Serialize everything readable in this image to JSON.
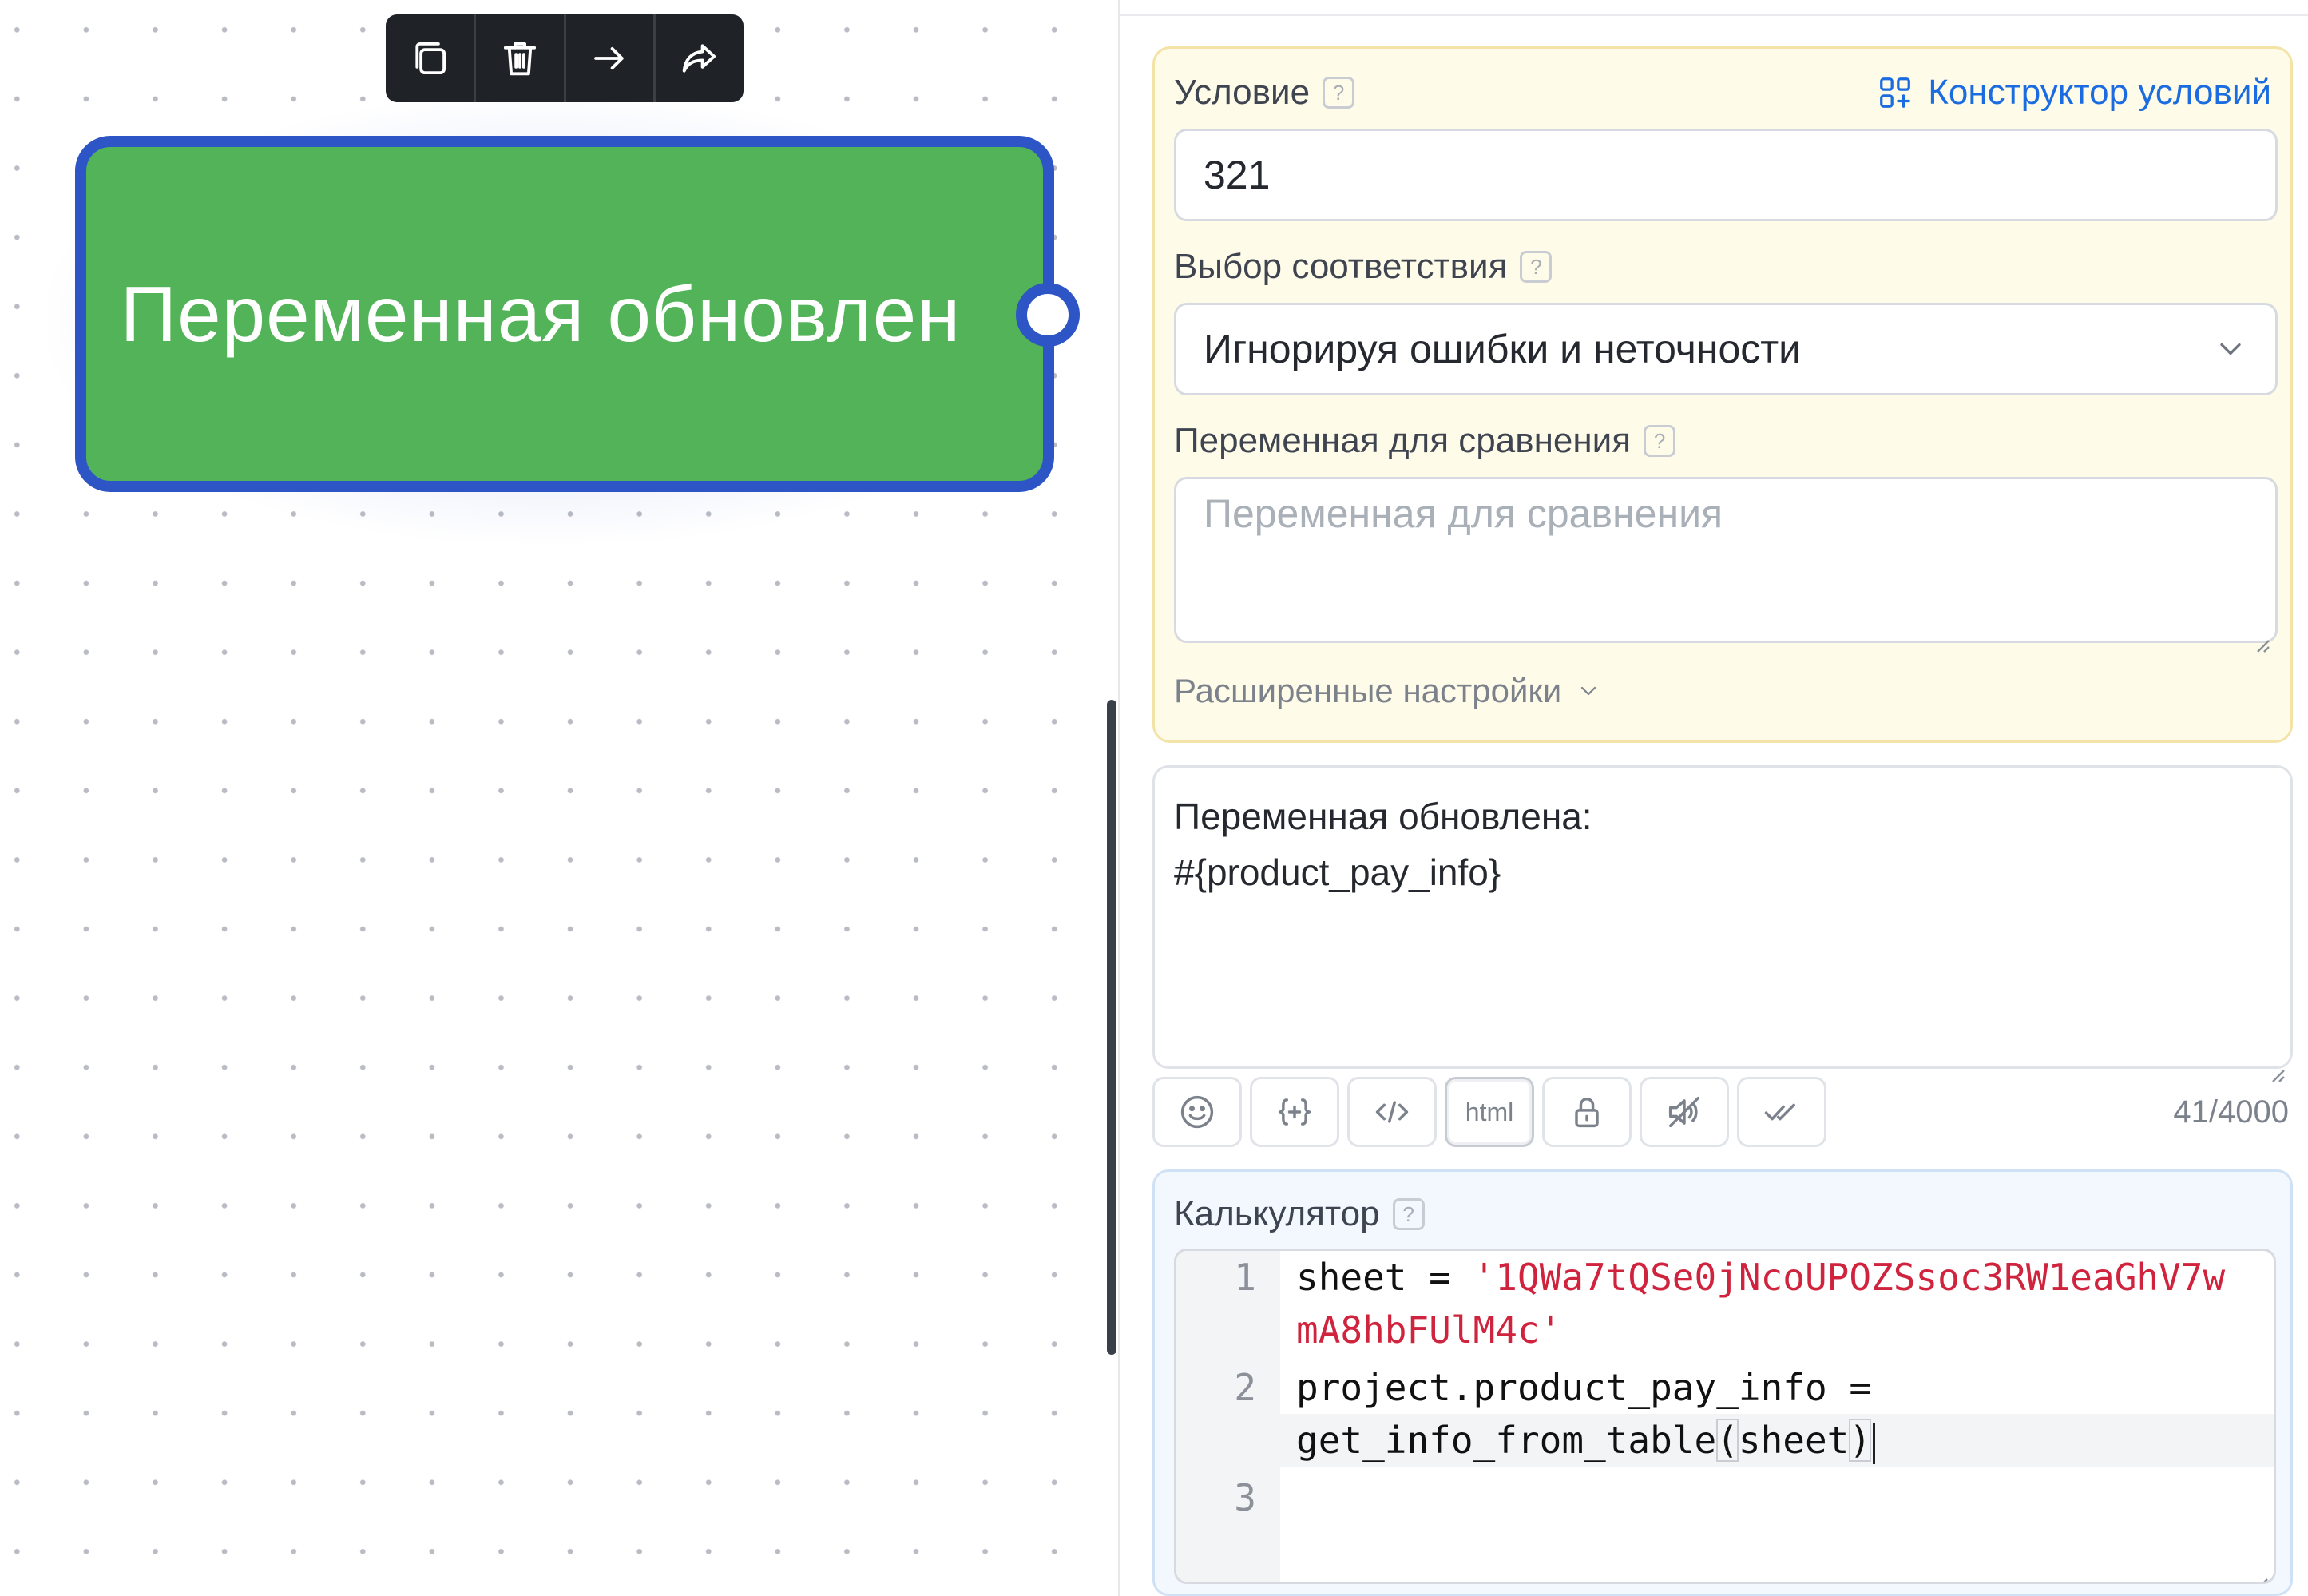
{
  "node": {
    "title": "Переменная обновлен",
    "toolbar": [
      {
        "name": "copy-icon",
        "label": "Копировать"
      },
      {
        "name": "trash-icon",
        "label": "Удалить"
      },
      {
        "name": "arrow-right-icon",
        "label": "Перейти"
      },
      {
        "name": "share-icon",
        "label": "Поделиться"
      }
    ]
  },
  "condition": {
    "label": "Условие",
    "builder_label": "Конструктор условий",
    "value": "321",
    "match_label": "Выбор соответствия",
    "match_value": "Игнорируя ошибки и неточности",
    "compare_label": "Переменная для сравнения",
    "compare_placeholder": "Переменная для сравнения",
    "advanced_label": "Расширенные настройки"
  },
  "message": {
    "line1": "Переменная обновлена:",
    "line2": "#{product_pay_info}",
    "toolbar": [
      {
        "name": "emoji-icon"
      },
      {
        "name": "variable-icon"
      },
      {
        "name": "code-icon"
      },
      {
        "name": "html-button",
        "label": "html"
      },
      {
        "name": "lock-icon"
      },
      {
        "name": "mute-icon"
      },
      {
        "name": "double-check-icon"
      }
    ],
    "counter": "41/4000"
  },
  "calculator": {
    "label": "Калькулятор",
    "lines": [
      {
        "num": "1",
        "pre": "sheet = ",
        "str_a": "'1QWa7tQSe0jNcoUPOZSsoc3RW1eaGhV7w",
        "str_b": "mA8hbFUlM4c'"
      },
      {
        "num": "2",
        "a": "project.product_pay_info =",
        "b1": "get_info_from_table",
        "b2": "(",
        "b3": "sheet",
        "b4": ")"
      },
      {
        "num": "3"
      }
    ]
  },
  "colors": {
    "node_fill": "#52b358",
    "node_border": "#2e55c6",
    "accent": "#1a6ce0",
    "string": "#d0233d"
  }
}
